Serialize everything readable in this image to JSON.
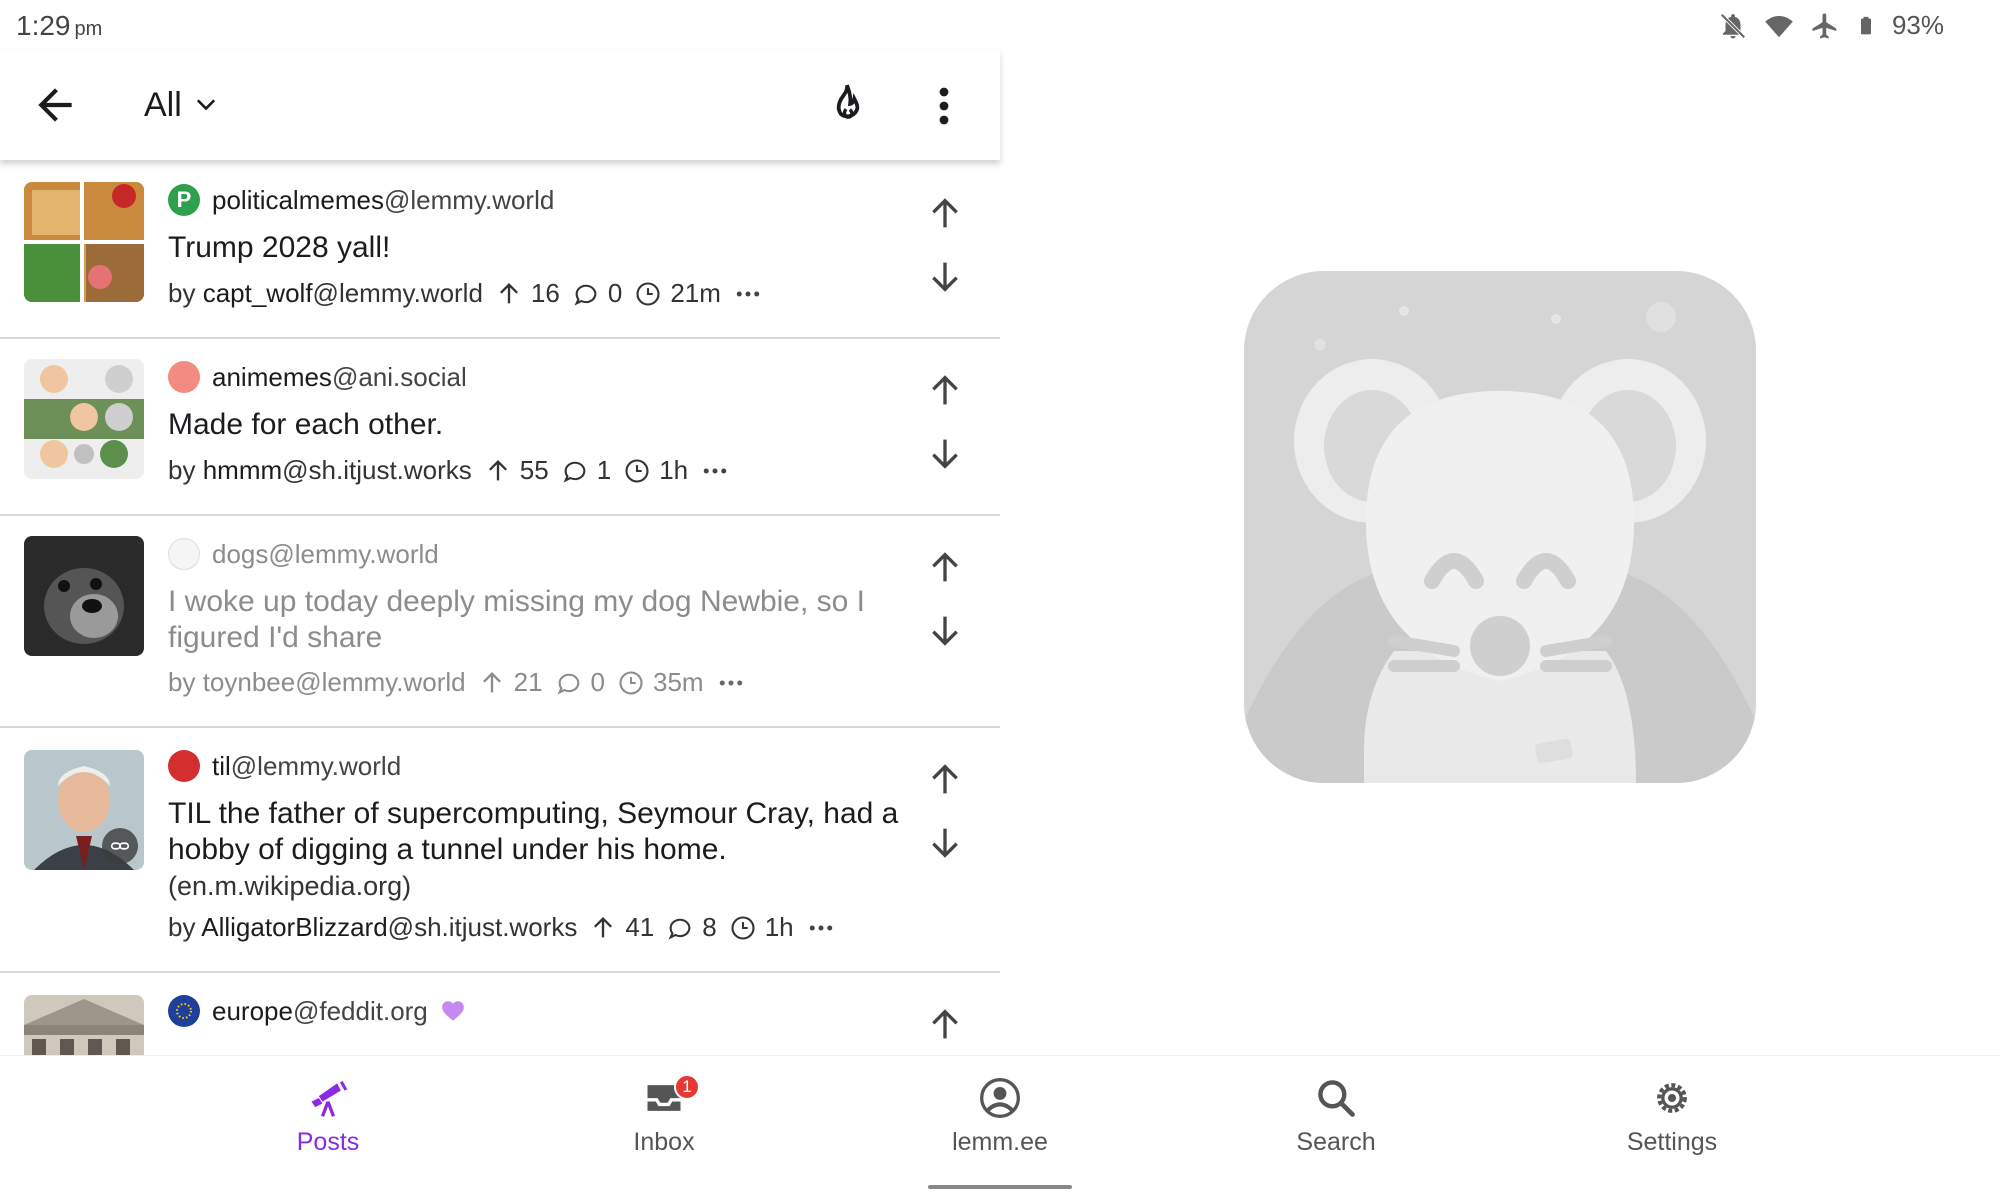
{
  "status_bar": {
    "time": "1:29",
    "ampm": "pm",
    "battery": "93%",
    "icons": [
      "bell-off-icon",
      "wifi-icon",
      "airplane-icon",
      "battery-icon"
    ]
  },
  "app_bar": {
    "feed_label": "All",
    "icons": [
      "back-arrow-icon",
      "chevron-down-icon",
      "flame-icon",
      "more-vert-icon"
    ]
  },
  "posts": [
    {
      "community": "politicalmemes",
      "instance": "@lemmy.world",
      "community_icon_letter": "P",
      "title": "Trump 2028 yall!",
      "domain": "",
      "author_prefix": "by",
      "author": "capt_wolf",
      "author_instance": "@lemmy.world",
      "score": "16",
      "comments": "0",
      "age": "21m",
      "read": false
    },
    {
      "community": "animemes",
      "instance": "@ani.social",
      "community_icon_letter": "",
      "title": "Made for each other.",
      "domain": "",
      "author_prefix": "by",
      "author": "hmmm",
      "author_instance": "@sh.itjust.works",
      "score": "55",
      "comments": "1",
      "age": "1h",
      "read": false
    },
    {
      "community": "dogs",
      "instance": "@lemmy.world",
      "community_icon_letter": "",
      "title": "I woke up today deeply missing my dog Newbie, so I figured I'd share",
      "domain": "",
      "author_prefix": "by",
      "author": "toynbee",
      "author_instance": "@lemmy.world",
      "score": "21",
      "comments": "0",
      "age": "35m",
      "read": true
    },
    {
      "community": "til",
      "instance": "@lemmy.world",
      "community_icon_letter": "",
      "title": "TIL the father of supercomputing, Seymour Cray, had a hobby of digging a tunnel under his home.",
      "domain": "(en.m.wikipedia.org)",
      "author_prefix": "by",
      "author": "AlligatorBlizzard",
      "author_instance": "@sh.itjust.works",
      "score": "41",
      "comments": "8",
      "age": "1h",
      "read": false
    },
    {
      "community": "europe",
      "instance": "@feddit.org",
      "community_icon_letter": "",
      "title": "",
      "domain": "",
      "author_prefix": "",
      "author": "",
      "author_instance": "",
      "score": "",
      "comments": "",
      "age": "",
      "read": false
    }
  ],
  "bottom_nav": {
    "items": [
      {
        "label": "Posts",
        "icon": "telescope-icon",
        "active": true
      },
      {
        "label": "Inbox",
        "icon": "inbox-icon",
        "badge": "1"
      },
      {
        "label": "lemm.ee",
        "icon": "account-circle-icon"
      },
      {
        "label": "Search",
        "icon": "search-icon"
      },
      {
        "label": "Settings",
        "icon": "settings-gear-icon"
      }
    ]
  },
  "colors": {
    "accent": "#8a2be2",
    "divider": "#d8d8d8",
    "read_text": "#8c8c8c",
    "badge": "#e53935"
  }
}
